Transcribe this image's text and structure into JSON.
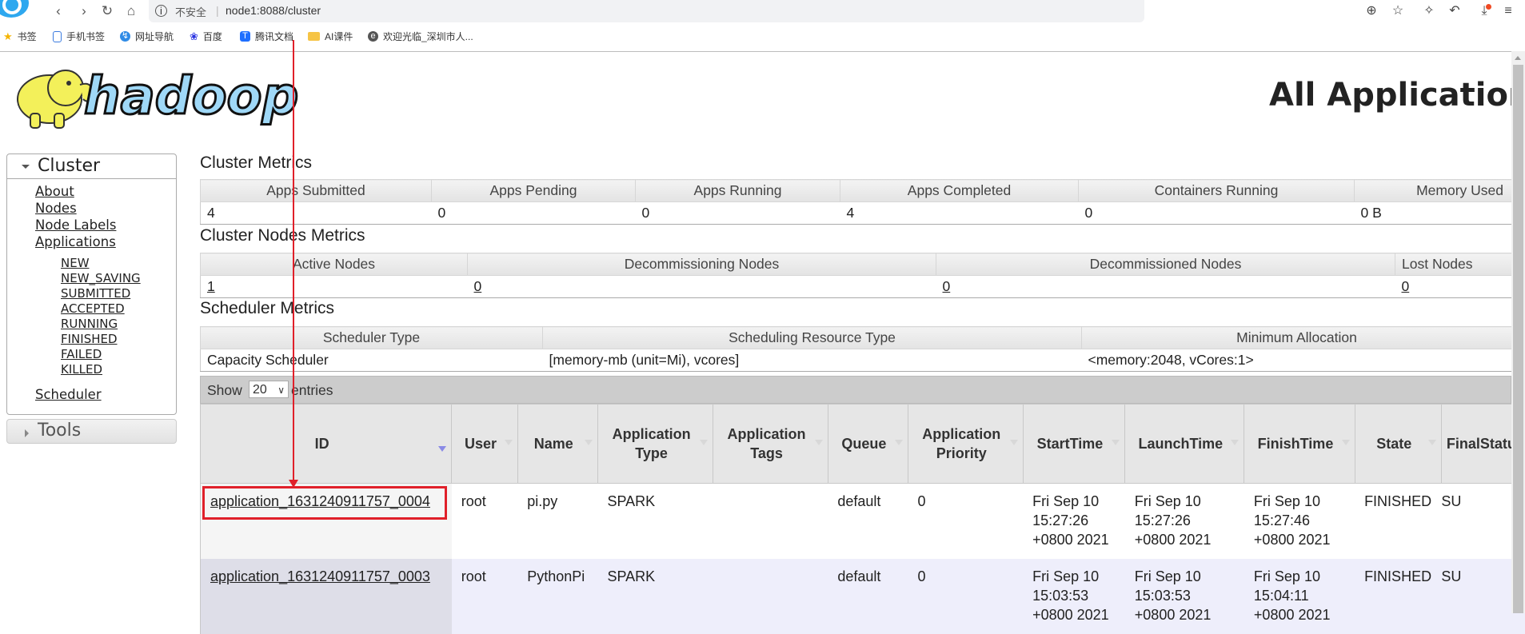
{
  "browser": {
    "security_label": "不安全",
    "url": "node1:8088/cluster",
    "bookmarks": [
      {
        "label": "书签",
        "icon": "star-icon"
      },
      {
        "label": "手机书签",
        "icon": "phone-bookmark-icon"
      },
      {
        "label": "网址导航",
        "icon": "navigation-icon"
      },
      {
        "label": "百度",
        "icon": "baidu-paw-icon"
      },
      {
        "label": "腾讯文档",
        "icon": "tencent-docs-icon"
      },
      {
        "label": "AI课件",
        "icon": "folder-icon"
      },
      {
        "label": "欢迎光临_深圳市人...",
        "icon": "site-icon"
      }
    ]
  },
  "header": {
    "title": "All Applications"
  },
  "sidebar": {
    "cluster_label": "Cluster",
    "links": [
      "About",
      "Nodes",
      "Node Labels",
      "Applications"
    ],
    "app_states": [
      "NEW",
      "NEW_SAVING",
      "SUBMITTED",
      "ACCEPTED",
      "RUNNING",
      "FINISHED",
      "FAILED",
      "KILLED"
    ],
    "scheduler_label": "Scheduler",
    "tools_label": "Tools"
  },
  "cluster_metrics": {
    "title": "Cluster Metrics",
    "headers": [
      "Apps Submitted",
      "Apps Pending",
      "Apps Running",
      "Apps Completed",
      "Containers Running",
      "Memory Used"
    ],
    "values": [
      "4",
      "0",
      "0",
      "4",
      "0",
      "0 B"
    ]
  },
  "nodes_metrics": {
    "title": "Cluster Nodes Metrics",
    "headers": [
      "Active Nodes",
      "Decommissioning Nodes",
      "Decommissioned Nodes",
      "Lost Nodes"
    ],
    "values": [
      "1",
      "0",
      "0",
      "0"
    ]
  },
  "scheduler_metrics": {
    "title": "Scheduler Metrics",
    "headers": [
      "Scheduler Type",
      "Scheduling Resource Type",
      "Minimum Allocation"
    ],
    "values": [
      "Capacity Scheduler",
      "[memory-mb (unit=Mi), vcores]",
      "<memory:2048, vCores:1>"
    ]
  },
  "apps_table": {
    "show_label": "Show",
    "entries_label": "entries",
    "page_size": "20",
    "headers": [
      "ID",
      "User",
      "Name",
      "Application Type",
      "Application Tags",
      "Queue",
      "Application Priority",
      "StartTime",
      "LaunchTime",
      "FinishTime",
      "State",
      "FinalStatus"
    ],
    "rows": [
      {
        "id": "application_1631240911757_0004",
        "user": "root",
        "name": "pi.py",
        "type": "SPARK",
        "tags": "",
        "queue": "default",
        "priority": "0",
        "start": [
          "Fri Sep 10",
          "15:27:26",
          "+0800 2021"
        ],
        "launch": [
          "Fri Sep 10",
          "15:27:26",
          "+0800 2021"
        ],
        "finish": [
          "Fri Sep 10",
          "15:27:46",
          "+0800 2021"
        ],
        "state": "FINISHED",
        "final_status": "SU"
      },
      {
        "id": "application_1631240911757_0003",
        "user": "root",
        "name": "PythonPi",
        "type": "SPARK",
        "tags": "",
        "queue": "default",
        "priority": "0",
        "start": [
          "Fri Sep 10",
          "15:03:53",
          "+0800 2021"
        ],
        "launch": [
          "Fri Sep 10",
          "15:03:53",
          "+0800 2021"
        ],
        "finish": [
          "Fri Sep 10",
          "15:04:11",
          "+0800 2021"
        ],
        "state": "FINISHED",
        "final_status": "SU"
      }
    ]
  },
  "annotation": {
    "color": "#e0202a"
  }
}
